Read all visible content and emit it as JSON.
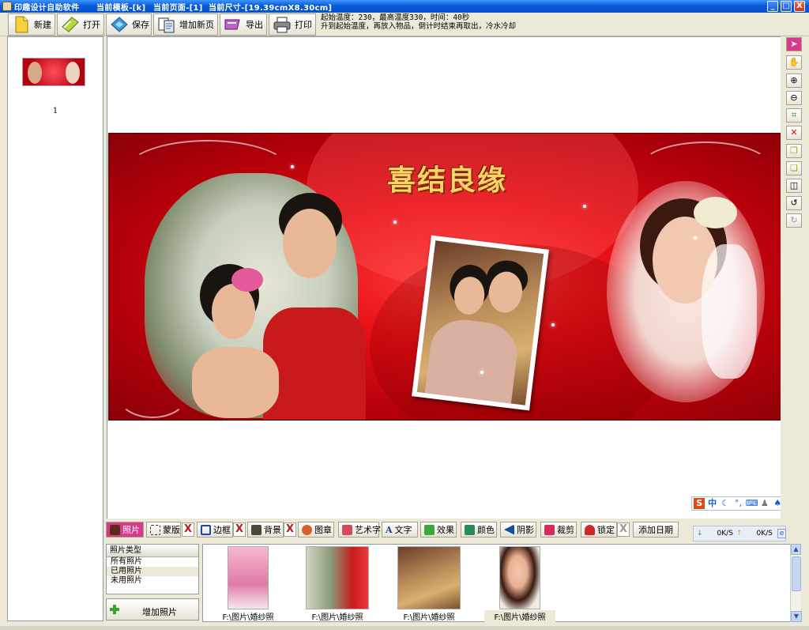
{
  "titlebar": {
    "app_name": "印趣设计自助软件",
    "template": "当前模板-[k]",
    "page": "当前页面-[1]",
    "size": "当前尺寸-[19.39cmX8.30cm]",
    "min": "_",
    "max": "□",
    "close": "X"
  },
  "toolbar": {
    "new": "新建",
    "open": "打开",
    "save": "保存",
    "add_page": "增加新页",
    "export": "导出",
    "print": "打印"
  },
  "info": {
    "line1": "起始温度：230，最高温度330，时间：40秒",
    "line2": "升到起始温度，再放入物品，倒计时结束再取出，冷水冷却"
  },
  "pages": {
    "page_number": "1"
  },
  "design": {
    "title": "喜结良缘"
  },
  "tabs": {
    "photo": "照片",
    "mask": "蒙版",
    "border": "边框",
    "background": "背景",
    "stamp": "图章",
    "art_text": "艺术字",
    "text": "文字",
    "effect": "效果",
    "color": "颜色",
    "shadow": "阴影",
    "crop": "裁剪",
    "lock": "锁定",
    "add_date": "添加日期",
    "text_icon": "A",
    "x": "X"
  },
  "ime": {
    "lang": "中"
  },
  "net": {
    "down": "0K/S",
    "up": "0K/S"
  },
  "categories": {
    "header": "照片类型",
    "items": [
      "所有照片",
      "已用照片",
      "未用照片"
    ]
  },
  "add_photo": "增加照片",
  "photos": [
    {
      "caption": "F:\\图片\\婚纱照"
    },
    {
      "caption": "F:\\图片\\婚纱照"
    },
    {
      "caption": "F:\\图片\\婚纱照"
    },
    {
      "caption": "F:\\图片\\婚纱照"
    }
  ],
  "icons": {
    "select": "select-arrow-icon",
    "hand": "hand-icon",
    "zoom_in": "zoom-in-icon",
    "zoom_out": "zoom-out-icon",
    "fit": "fit-screen-icon",
    "delete": "delete-icon",
    "bring_forward": "bring-forward-icon",
    "send_backward": "send-backward-icon",
    "flip": "flip-icon",
    "undo": "undo-icon",
    "redo": "redo-icon"
  }
}
